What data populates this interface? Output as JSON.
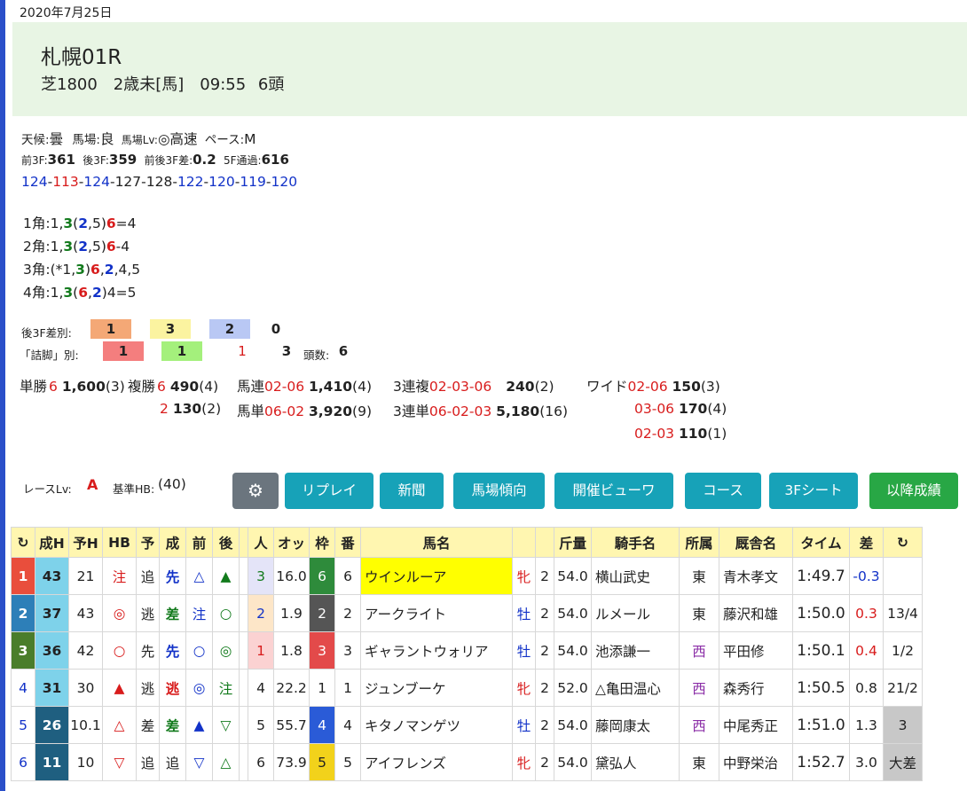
{
  "date": "2020年7月25日",
  "race": {
    "title": "札幌01R",
    "sub": "芝1800　2歳未[馬]　09:55 6頭"
  },
  "cond": {
    "weather_l": "天候:",
    "weather": "曇",
    "track_l": "馬場:",
    "track": "良",
    "lv_l": "馬場Lv:",
    "lv": "◎高速",
    "pace_l": "ペース:",
    "pace": "M"
  },
  "times": {
    "f3_l": "前3F:",
    "f3": "361",
    "l3_l": "後3F:",
    "l3": "359",
    "diff_l": "前後3F差:",
    "diff": "0.2",
    "f5_l": "5F通過:",
    "f5": "616"
  },
  "laps": [
    "124",
    "113",
    "124",
    "127",
    "128",
    "122",
    "120",
    "119",
    "120"
  ],
  "corners": [
    [
      "1角:1,",
      "3",
      "(",
      "2",
      ",5)",
      "6",
      "=4"
    ],
    [
      "2角:1,",
      "3",
      "(",
      "2",
      ",5)",
      "6",
      "-4"
    ],
    [
      "3角:(*1,",
      "3",
      ")",
      "6",
      ",",
      "2",
      ",4,5"
    ],
    [
      "4角:1,",
      "3",
      "(",
      "6",
      ",",
      "2",
      ")4=5"
    ]
  ],
  "stats": {
    "l3_label": "後3F差別:",
    "l3_vals": [
      "1",
      "3",
      "2",
      "0"
    ],
    "tsume_label": "「詰脚」別:",
    "tsume_vals": [
      "1",
      "1",
      "1",
      "3"
    ],
    "heads_label": "頭数:",
    "heads": "6"
  },
  "payouts": {
    "tansho_l": "単勝",
    "tansho_n": "6",
    "tansho_v": "1,600",
    "tansho_p": "(3)",
    "fuku_l": "複勝",
    "fuku_n1": "6",
    "fuku_v1": "490",
    "fuku_p1": "(4)",
    "fuku_n2": "2",
    "fuku_v2": "130",
    "fuku_p2": "(2)",
    "umaren_l": "馬連",
    "umaren_n": "02-06",
    "umaren_v": "1,410",
    "umaren_p": "(4)",
    "umatan_l": "馬単",
    "umatan_n": "06-02",
    "umatan_v": "3,920",
    "umatan_p": "(9)",
    "trio_l": "3連複",
    "trio_n": "02-03-06",
    "trio_v": "240",
    "trio_p": "(2)",
    "tri_l": "3連単",
    "tri_n": "06-02-03",
    "tri_v": "5,180",
    "tri_p": "(16)",
    "wide_l": "ワイド",
    "wide": [
      [
        "02-06",
        "150",
        "(3)"
      ],
      [
        "03-06",
        "170",
        "(4)"
      ],
      [
        "02-03",
        "110",
        "(1)"
      ]
    ]
  },
  "racelv": {
    "label": "レースLv:",
    "value": "A",
    "hb_label": "基準HB:",
    "hb": "(40)"
  },
  "buttons": [
    "リプレイ",
    "新聞",
    "馬場傾向",
    "開催ビューワ",
    "コース",
    "3Fシート",
    "以降成績"
  ],
  "table": {
    "headers": [
      "↻",
      "成H",
      "予H",
      "HB",
      "予",
      "成",
      "前",
      "後",
      "",
      "人",
      "オッ",
      "枠",
      "番",
      "馬名",
      "",
      "",
      "斤量",
      "騎手名",
      "所属",
      "厩舎名",
      "タイム",
      "差",
      "↻"
    ],
    "rows": [
      [
        "1",
        "43",
        "21",
        "注",
        "追",
        "先",
        "△",
        "▲",
        "",
        "3",
        "16.0",
        "6",
        "6",
        "ウインルーア",
        "牝",
        "2",
        "54.0",
        "横山武史",
        "東",
        "青木孝文",
        "1:49.7",
        "-0.3",
        ""
      ],
      [
        "2",
        "37",
        "43",
        "◎",
        "逃",
        "差",
        "注",
        "○",
        "",
        "2",
        "1.9",
        "2",
        "2",
        "アークライト",
        "牡",
        "2",
        "54.0",
        "ルメール",
        "東",
        "藤沢和雄",
        "1:50.0",
        "0.3",
        "13/4"
      ],
      [
        "3",
        "36",
        "42",
        "○",
        "先",
        "先",
        "○",
        "◎",
        "",
        "1",
        "1.8",
        "3",
        "3",
        "ギャラントウォリア",
        "牡",
        "2",
        "54.0",
        "池添謙一",
        "西",
        "平田修",
        "1:50.1",
        "0.4",
        "1/2"
      ],
      [
        "4",
        "31",
        "30",
        "▲",
        "逃",
        "逃",
        "◎",
        "注",
        "",
        "4",
        "22.2",
        "1",
        "1",
        "ジュンブーケ",
        "牝",
        "2",
        "52.0",
        "△亀田温心",
        "西",
        "森秀行",
        "1:50.5",
        "0.8",
        "21/2"
      ],
      [
        "5",
        "26",
        "10.1",
        "△",
        "差",
        "差",
        "▲",
        "▽",
        "",
        "5",
        "55.7",
        "4",
        "4",
        "キタノマンゲツ",
        "牡",
        "2",
        "54.0",
        "藤岡康太",
        "西",
        "中尾秀正",
        "1:51.0",
        "1.3",
        "3"
      ],
      [
        "6",
        "11",
        "10",
        "▽",
        "追",
        "追",
        "▽",
        "△",
        "",
        "6",
        "73.9",
        "5",
        "5",
        "アイフレンズ",
        "牝",
        "2",
        "54.0",
        "黛弘人",
        "東",
        "中野栄治",
        "1:52.7",
        "3.0",
        "大差"
      ]
    ]
  },
  "colors": {
    "waku1": "#ffffff",
    "waku2": "#555555",
    "waku3": "#e34a4a",
    "waku4": "#2a5bd7",
    "waku5": "#f2d21b",
    "waku6": "#2e8b3b"
  }
}
